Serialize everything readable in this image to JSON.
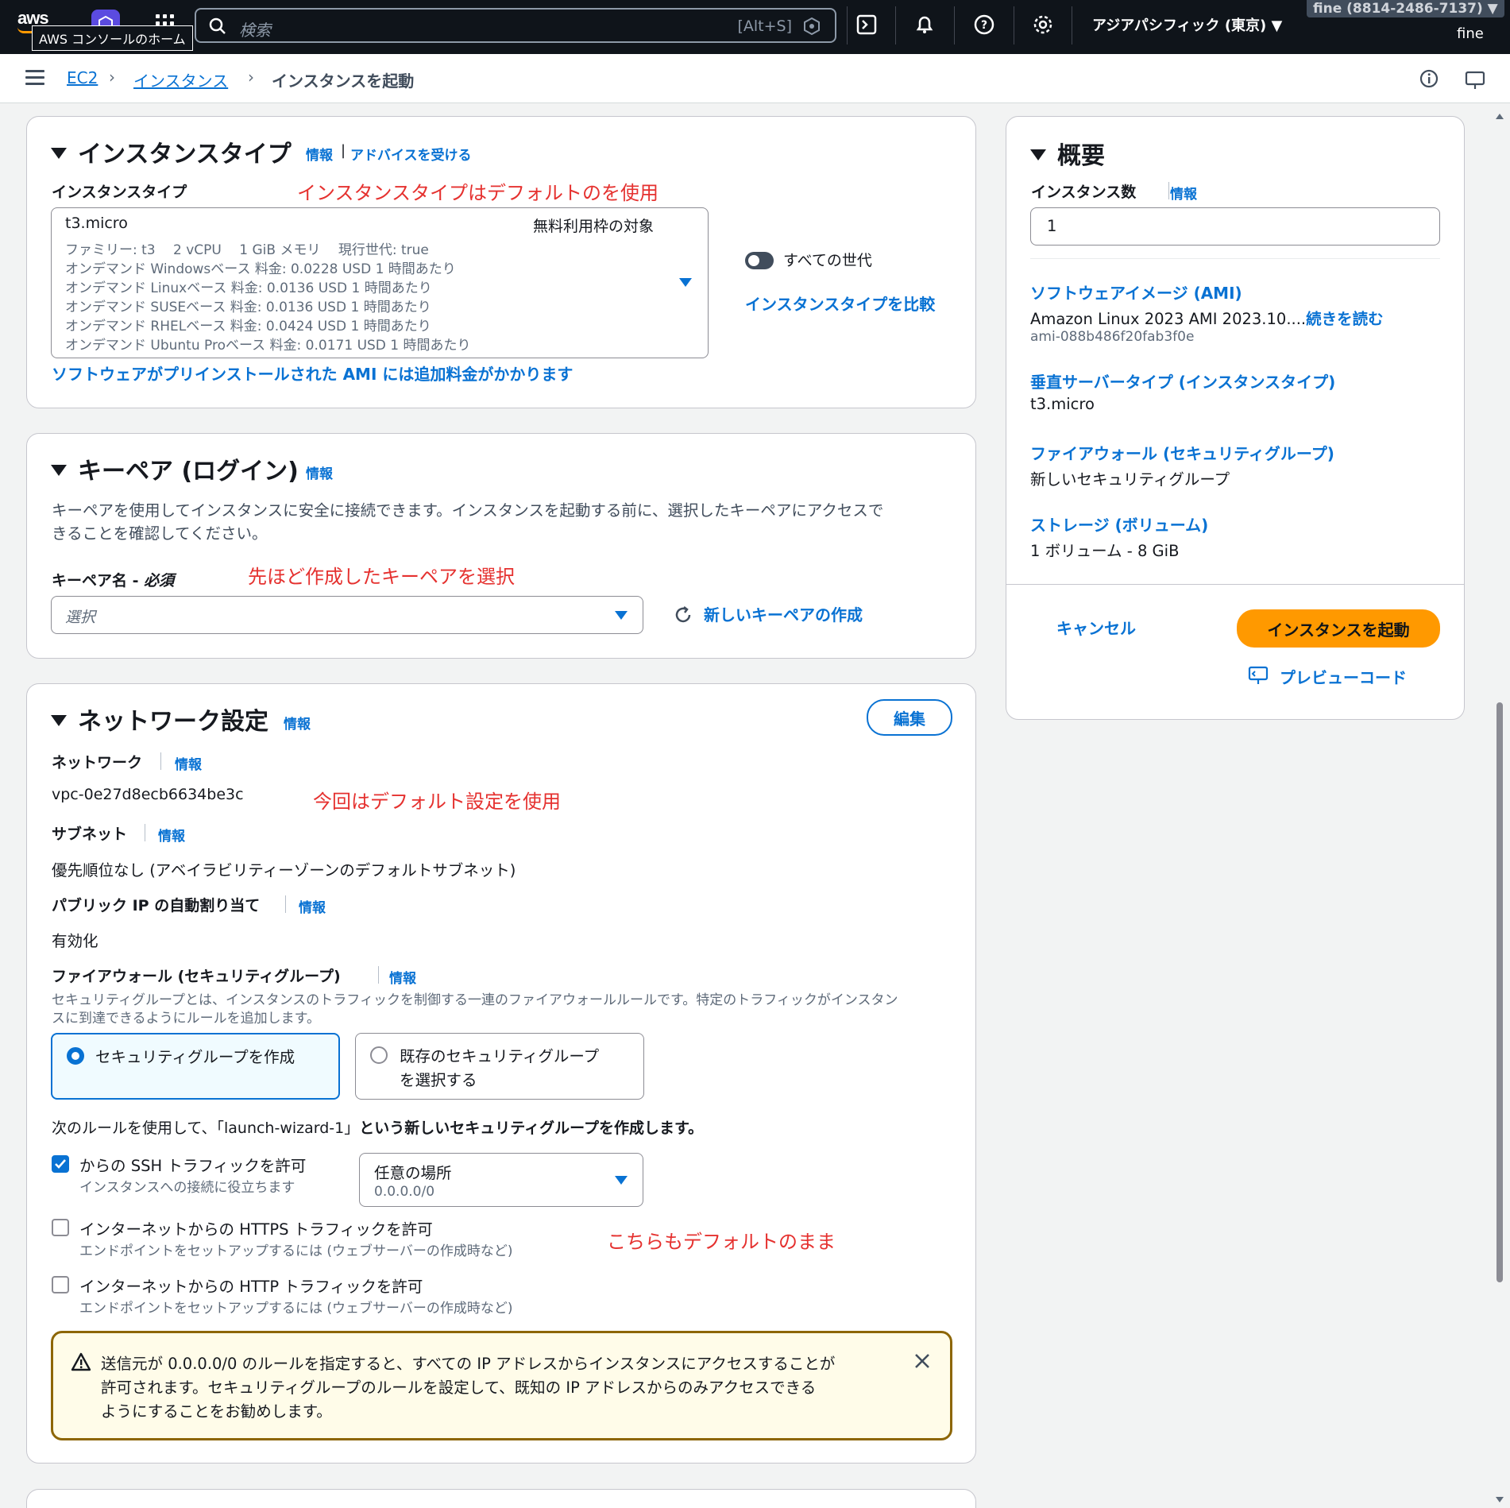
{
  "nav": {
    "logo": "aws",
    "tooltip": "AWS コンソールのホーム",
    "search_placeholder": "検索",
    "search_shortcut": "[Alt+S]",
    "region": "アジアパシフィック (東京) ▼",
    "account": "fine (8814-2486-7137) ▼",
    "user": "fine"
  },
  "breadcrumb": {
    "items": [
      "EC2",
      "インスタンス",
      "インスタンスを起動"
    ]
  },
  "instance_type": {
    "title": "インスタンスタイプ",
    "info": "情報",
    "advice": "アドバイスを受ける",
    "field_label": "インスタンスタイプ",
    "annotation": "インスタンスタイプはデフォルトのを使用",
    "selected": "t3.micro",
    "free_tier": "無料利用枠の対象",
    "details": [
      "ファミリー: t3　 2 vCPU　 1 GiB メモリ　 現行世代: true",
      "オンデマンド Windowsベース 料金: 0.0228 USD 1 時間あたり",
      "オンデマンド Linuxベース 料金: 0.0136 USD 1 時間あたり",
      "オンデマンド SUSEベース 料金: 0.0136 USD 1 時間あたり",
      "オンデマンド RHELベース 料金: 0.0424 USD 1 時間あたり",
      "オンデマンド Ubuntu Proベース 料金: 0.0171 USD 1 時間あたり"
    ],
    "all_generations": "すべての世代",
    "compare": "インスタンスタイプを比較",
    "ami_note": "ソフトウェアがプリインストールされた AMI には追加料金がかかります"
  },
  "key_pair": {
    "title": "キーペア (ログイン)",
    "info": "情報",
    "description_line1": "キーペアを使用してインスタンスに安全に接続できます。インスタンスを起動する前に、選択したキーペアにアクセスで",
    "description_line2": "きることを確認してください。",
    "name_label": "キーペア名 - ",
    "required": "必須",
    "annotation": "先ほど作成したキーペアを選択",
    "placeholder": "選択",
    "create_new": "新しいキーペアの作成"
  },
  "network": {
    "title": "ネットワーク設定",
    "info": "情報",
    "edit": "編集",
    "network_label": "ネットワーク",
    "network_value": "vpc-0e27d8ecb6634be3c",
    "annotation": "今回はデフォルト設定を使用",
    "subnet_label": "サブネット",
    "subnet_value": "優先順位なし (アベイラビリティーゾーンのデフォルトサブネット)",
    "public_ip_label": "パブリック IP の自動割り当て",
    "public_ip_value": "有効化",
    "firewall_label": "ファイアウォール (セキュリティグループ)",
    "firewall_desc_line1": "セキュリティグループとは、インスタンスのトラフィックを制御する一連のファイアウォールルールです。特定のトラフィックがインスタン",
    "firewall_desc_line2": "スに到達できるようにルールを追加します。",
    "option_create": "セキュリティグループを作成",
    "option_existing_line1": "既存のセキュリティグループ",
    "option_existing_line2": "を選択する",
    "rule_intro_a": "次のルールを使用して、「launch-wizard-1」",
    "rule_intro_b": "という新しいセキュリティグループを作成します。",
    "ssh_label": "からの SSH トラフィックを許可",
    "ssh_help": "インスタンスへの接続に役立ちます",
    "ssh_source": "任意の場所",
    "ssh_cidr": "0.0.0.0/0",
    "https_label": "インターネットからの HTTPS トラフィックを許可",
    "https_help": "エンドポイントをセットアップするには (ウェブサーバーの作成時など)",
    "http_label": "インターネットからの HTTP トラフィックを許可",
    "http_help": "エンドポイントをセットアップするには (ウェブサーバーの作成時など)",
    "annotation2": "こちらもデフォルトのまま",
    "warning_line1": "送信元が 0.0.0.0/0 のルールを指定すると、すべての IP アドレスからインスタンスにアクセスすることが",
    "warning_line2": "許可されます。セキュリティグループのルールを設定して、既知の IP アドレスからのみアクセスできる",
    "warning_line3": "ようにすることをお勧めします。"
  },
  "summary": {
    "title": "概要",
    "count_label": "インスタンス数",
    "info": "情報",
    "count_value": "1",
    "ami_label": "ソフトウェアイメージ (AMI)",
    "ami_value": "Amazon Linux 2023 AMI 2023.10....",
    "ami_more": "続きを読む",
    "ami_id": "ami-088b486f20fab3f0e",
    "type_label": "垂直サーバータイプ (インスタンスタイプ)",
    "type_value": "t3.micro",
    "firewall_label": "ファイアウォール (セキュリティグループ)",
    "firewall_value": "新しいセキュリティグループ",
    "storage_label": "ストレージ (ボリューム)",
    "storage_value": "1 ボリューム - 8 GiB",
    "cancel": "キャンセル",
    "launch": "インスタンスを起動",
    "preview": "プレビューコード"
  }
}
